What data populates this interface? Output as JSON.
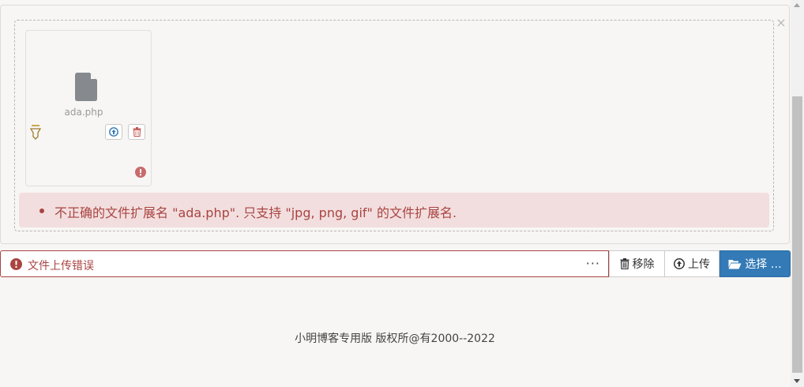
{
  "upload_panel": {
    "close_glyph": "×",
    "file": {
      "name": "ada.php",
      "icon": "file-icon",
      "actions": [
        "upload-icon",
        "trash-icon"
      ],
      "status_icon": "exclamation-circle-icon"
    },
    "error_message": "不正确的文件扩展名 \"ada.php\". 只支持 \"jpg, png, gif\" 的文件扩展名."
  },
  "input_group": {
    "caption": "文件上传错误",
    "more_glyph": "···",
    "remove_label": "移除",
    "upload_label": "上传",
    "select_label": "选择 …"
  },
  "footer": {
    "text": "小明博客专用版 版权所@有2000--2022"
  },
  "colors": {
    "error": "#a94442",
    "error_bg": "#f2dede",
    "primary": "#337ab7",
    "page_bg": "#f7f6f4"
  }
}
